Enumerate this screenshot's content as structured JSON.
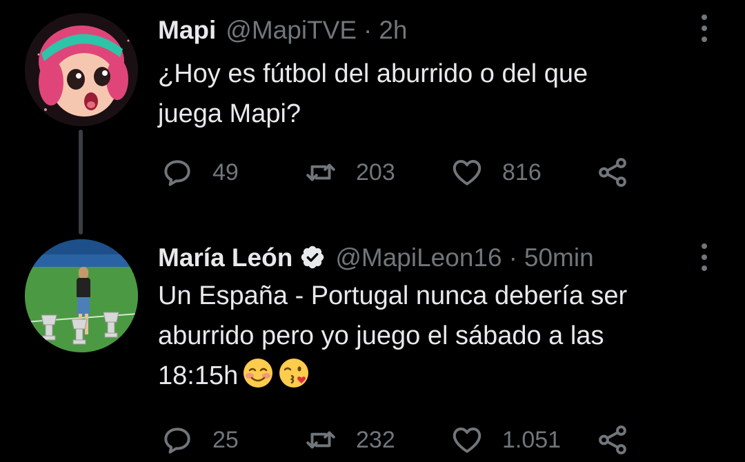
{
  "tweets": [
    {
      "name": "Mapi",
      "handle": "@MapiTVE",
      "separator": "·",
      "time": "2h",
      "text_lines": [
        "¿Hoy es fútbol del aburrido o del que",
        "juega Mapi?"
      ],
      "replies": "49",
      "retweets": "203",
      "likes": "816",
      "verified": false,
      "avatar": "cartoon-girl-avatar"
    },
    {
      "name": "María León",
      "handle": "@MapiLeon16",
      "separator": "·",
      "time": "50min",
      "text_lines": [
        "Un España - Portugal nunca debería ser",
        "aburrido pero yo juego el sábado a las",
        "18:15h"
      ],
      "emojis": [
        "smiling-face-with-blushed-cheeks",
        "face-blowing-a-kiss"
      ],
      "replies": "25",
      "retweets": "232",
      "likes": "1.051",
      "verified": true,
      "avatar": "player-with-trophies-avatar"
    }
  ],
  "colors": {
    "background": "#000000",
    "primary_text": "#e7e9ea",
    "secondary_text": "#71767b",
    "thread_line": "#3a3d41",
    "verified_badge": "#e7e9ea"
  }
}
